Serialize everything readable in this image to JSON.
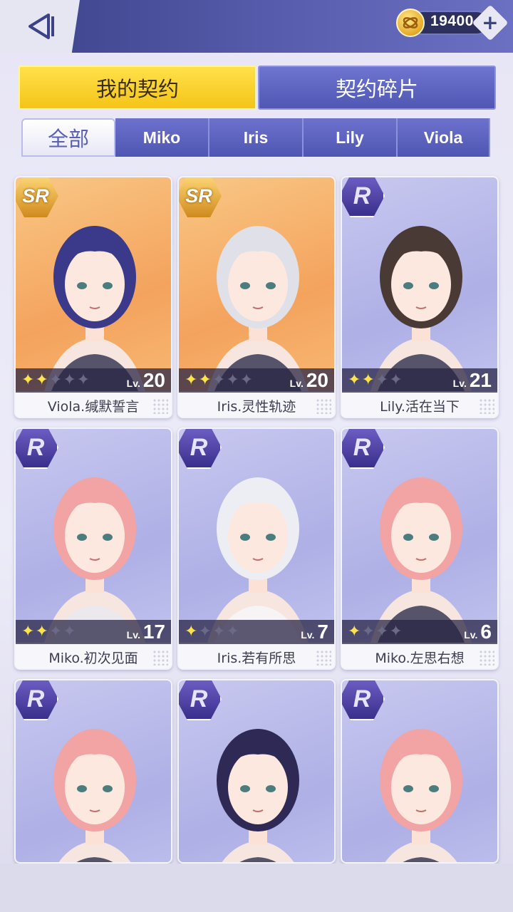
{
  "header": {
    "coins": "19400"
  },
  "main_tabs": [
    {
      "label": "我的契约",
      "active": true
    },
    {
      "label": "契约碎片",
      "active": false
    }
  ],
  "filter_tabs": [
    {
      "label": "全部",
      "active": true
    },
    {
      "label": "Miko",
      "active": false
    },
    {
      "label": "Iris",
      "active": false
    },
    {
      "label": "Lily",
      "active": false
    },
    {
      "label": "Viola",
      "active": false
    }
  ],
  "cards": [
    {
      "name": "Viola.缄默誓言",
      "rarity": "SR",
      "stars_filled": 2,
      "stars_total": 5,
      "lv_label": "Lv.",
      "level": "20",
      "hair": "#3b3a8a"
    },
    {
      "name": "Iris.灵性轨迹",
      "rarity": "SR",
      "stars_filled": 2,
      "stars_total": 5,
      "lv_label": "Lv.",
      "level": "20",
      "hair": "#dfe0e8"
    },
    {
      "name": "Lily.活在当下",
      "rarity": "R",
      "stars_filled": 2,
      "stars_total": 4,
      "lv_label": "Lv.",
      "level": "21",
      "hair": "#4a3a36"
    },
    {
      "name": "Miko.初次见面",
      "rarity": "R",
      "stars_filled": 2,
      "stars_total": 4,
      "lv_label": "Lv.",
      "level": "17",
      "hair": "#f2a3a3"
    },
    {
      "name": "Iris.若有所思",
      "rarity": "R",
      "stars_filled": 1,
      "stars_total": 4,
      "lv_label": "Lv.",
      "level": "7",
      "hair": "#eceef4"
    },
    {
      "name": "Miko.左思右想",
      "rarity": "R",
      "stars_filled": 1,
      "stars_total": 4,
      "lv_label": "Lv.",
      "level": "6",
      "hair": "#f2a3a3"
    },
    {
      "name": "",
      "rarity": "R",
      "hair": "#f2a3a3"
    },
    {
      "name": "",
      "rarity": "R",
      "hair": "#2e2a55"
    },
    {
      "name": "",
      "rarity": "R",
      "hair": "#f2a3a3"
    }
  ],
  "colors": {
    "header_bg": "#4a4f9e",
    "active_tab": "#f7cb1f",
    "inactive_tab": "#5a60bc",
    "star_on": "#ffe34d"
  },
  "icons": {
    "back": "back-arrow-icon",
    "coin": "coin-icon",
    "add": "plus-icon"
  }
}
